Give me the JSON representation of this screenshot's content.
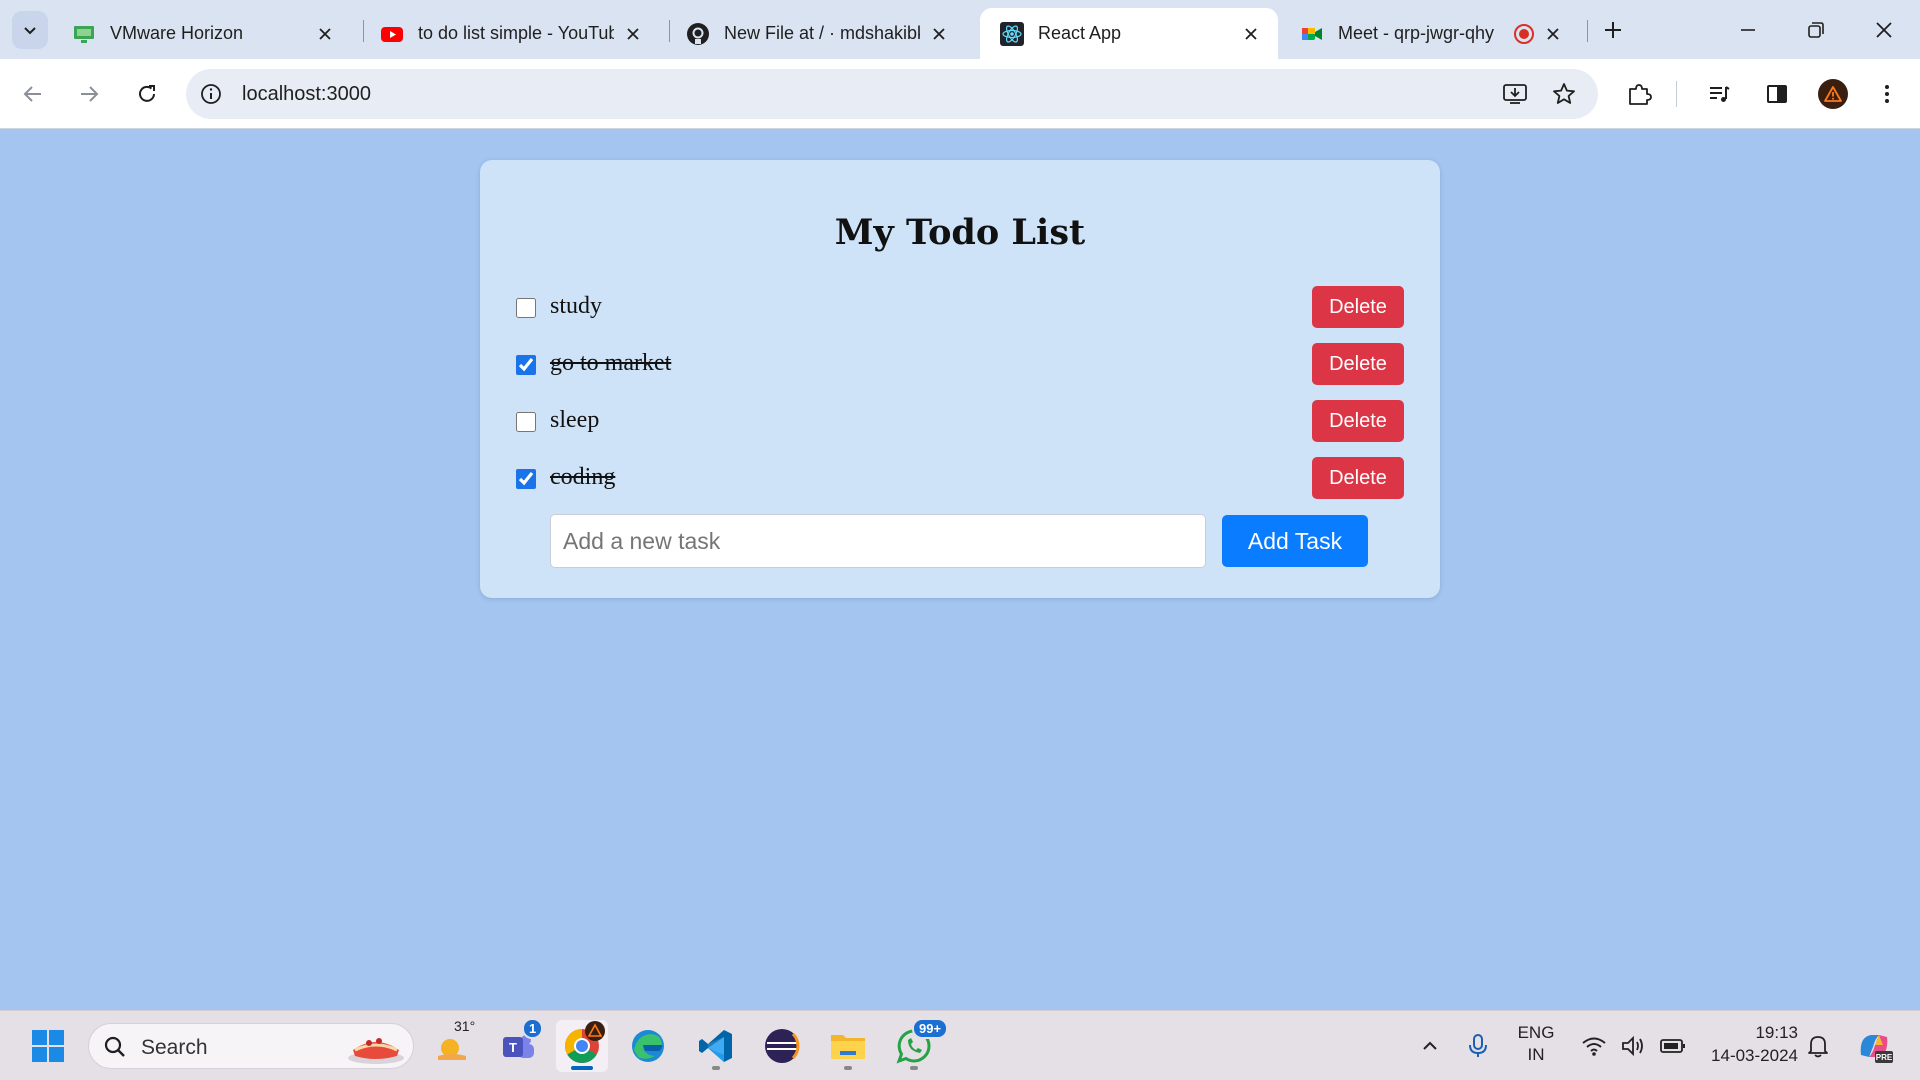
{
  "browser": {
    "tabs": [
      {
        "title": "VMware Horizon",
        "icon": "vmware-horizon-icon",
        "active": false
      },
      {
        "title": "to do list simple - YouTube",
        "icon": "youtube-icon",
        "active": false
      },
      {
        "title": "New File at / · mdshakibkh",
        "icon": "github-icon",
        "active": false
      },
      {
        "title": "React App",
        "icon": "react-icon",
        "active": true
      },
      {
        "title": "Meet - qrp-jwgr-qhy",
        "icon": "google-meet-icon",
        "active": false
      }
    ],
    "address": "localhost:3000"
  },
  "todo": {
    "title": "My Todo List",
    "items": [
      {
        "text": "study",
        "completed": false
      },
      {
        "text": "go to market",
        "completed": true
      },
      {
        "text": "sleep",
        "completed": false
      },
      {
        "text": "coding",
        "completed": true
      }
    ],
    "delete_label": "Delete",
    "input_placeholder": "Add a new task",
    "add_label": "Add Task"
  },
  "taskbar": {
    "search_label": "Search",
    "weather_temp": "31°",
    "teams_badge": "1",
    "whatsapp_badge": "99+",
    "language_line1": "ENG",
    "language_line2": "IN",
    "time": "19:13",
    "date": "14-03-2024"
  },
  "colors": {
    "page_background": "#a3c5ef",
    "card_background": "#cfe3f8",
    "delete_button": "#dc3545",
    "add_button": "#0a7cff"
  }
}
